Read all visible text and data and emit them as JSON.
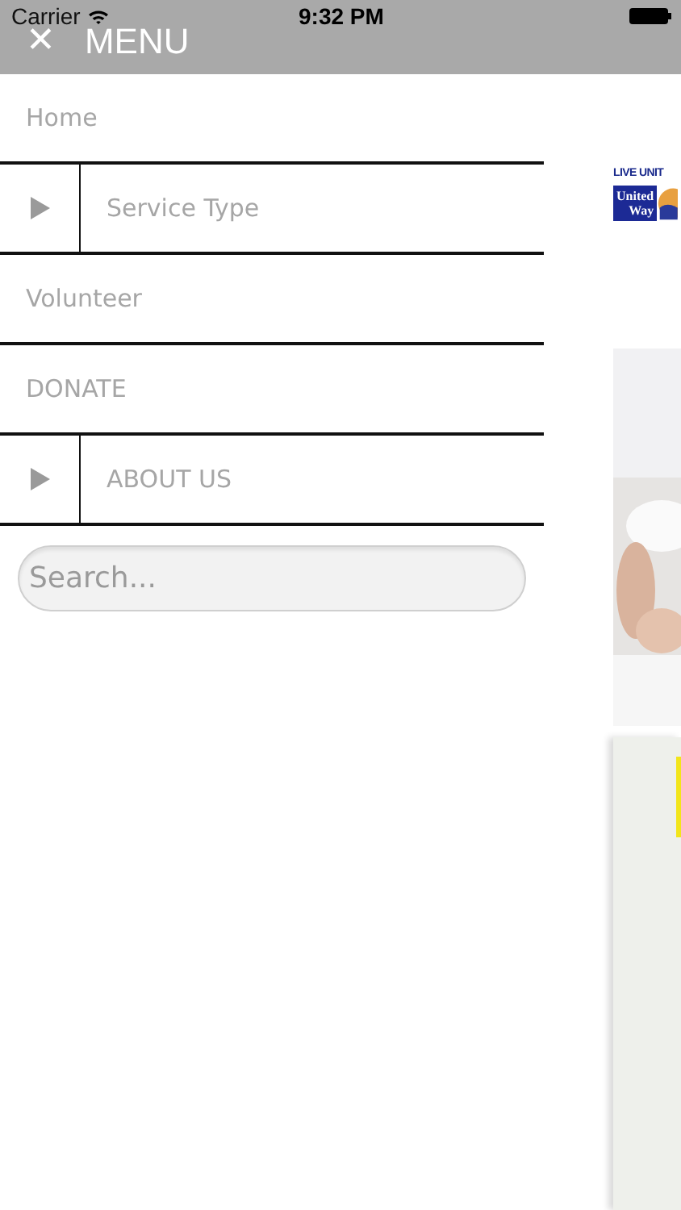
{
  "status_bar": {
    "carrier": "Carrier",
    "time": "9:32 PM"
  },
  "header": {
    "close_glyph": "✕",
    "title": "MENU"
  },
  "menu": {
    "items": [
      {
        "label": "Home",
        "kind": "link"
      },
      {
        "label": "Service Type",
        "kind": "expandable",
        "expanded": false
      },
      {
        "label": "Volunteer",
        "kind": "link"
      },
      {
        "label": "DONATE",
        "kind": "link"
      },
      {
        "label": "ABOUT US",
        "kind": "expandable",
        "expanded": false
      }
    ]
  },
  "search": {
    "placeholder": "Search..."
  },
  "page": {
    "logo": {
      "tagline": "LIVE UNIT",
      "name_line_1": "United",
      "name_line_2": "Way"
    }
  }
}
